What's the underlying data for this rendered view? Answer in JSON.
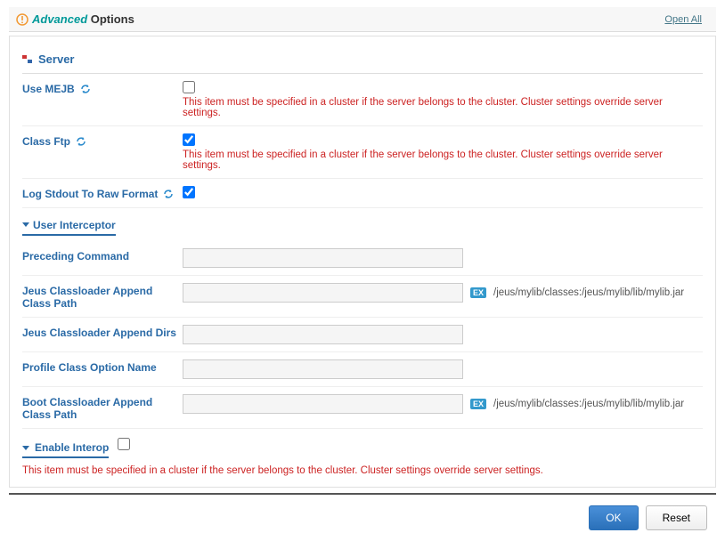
{
  "header": {
    "advanced": "Advanced",
    "options": " Options",
    "open_all": "Open All"
  },
  "server": {
    "title": "Server",
    "use_mejb": {
      "label": "Use MEJB",
      "checked": false,
      "warning": "This item must be specified in a cluster if the server belongs to the cluster. Cluster settings override server settings."
    },
    "class_ftp": {
      "label": "Class Ftp",
      "checked": true,
      "warning": "This item must be specified in a cluster if the server belongs to the cluster. Cluster settings override server settings."
    },
    "log_stdout": {
      "label": "Log Stdout To Raw Format",
      "checked": true
    },
    "user_interceptor": {
      "title": "User Interceptor",
      "fields": {
        "preceding_command": {
          "label": "Preceding Command",
          "value": ""
        },
        "jeus_classloader_append_class_path": {
          "label": "Jeus Classloader Append Class Path",
          "value": "",
          "ex": "/jeus/mylib/classes:/jeus/mylib/lib/mylib.jar"
        },
        "jeus_classloader_append_dirs": {
          "label": "Jeus Classloader Append Dirs",
          "value": ""
        },
        "profile_class_option_name": {
          "label": "Profile Class Option Name",
          "value": ""
        },
        "boot_classloader_append_class_path": {
          "label": "Boot Classloader Append Class Path",
          "value": "",
          "ex": "/jeus/mylib/classes:/jeus/mylib/lib/mylib.jar"
        }
      }
    },
    "enable_interop": {
      "label": "Enable Interop",
      "checked": false,
      "warning": "This item must be specified in a cluster if the server belongs to the cluster. Cluster settings override server settings."
    }
  },
  "ex_label": "EX",
  "buttons": {
    "ok": "OK",
    "reset": "Reset"
  }
}
